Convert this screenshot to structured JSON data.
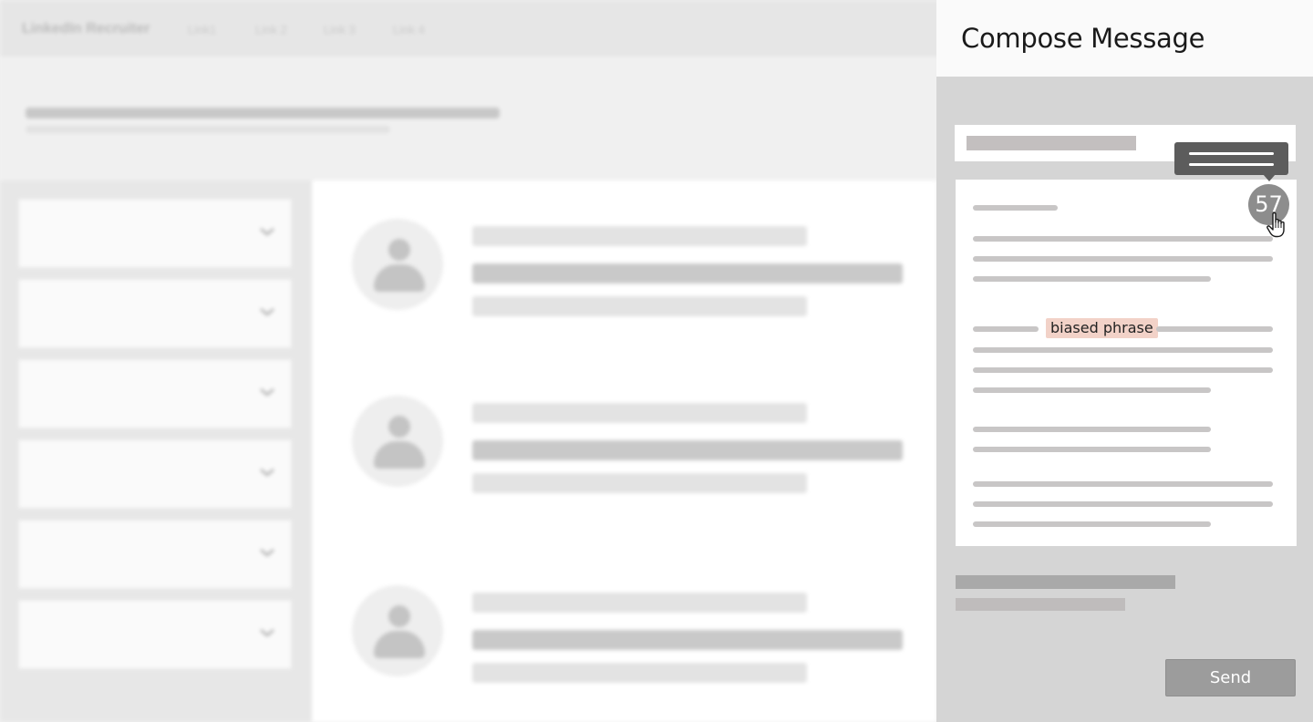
{
  "background_app": {
    "brand": "LinkedIn Recruiter",
    "nav_links": [
      "Link1",
      "Link 2",
      "Link 3",
      "Link 4"
    ],
    "filter_count": 6,
    "result_count": 3
  },
  "compose": {
    "title": "Compose Message",
    "highlight": {
      "text": "biased phrase",
      "color": "#f2d2c8"
    },
    "score": "57",
    "send_label": "Send"
  },
  "colors": {
    "panel_bg": "#d5d5d5",
    "tooltip_bg": "#5c5c5c",
    "badge_bg": "#8d8d8d",
    "button_bg": "#9c9c9c"
  },
  "icons": [
    "chevron-down-icon",
    "avatar-placeholder-icon",
    "hand-pointer-icon"
  ]
}
